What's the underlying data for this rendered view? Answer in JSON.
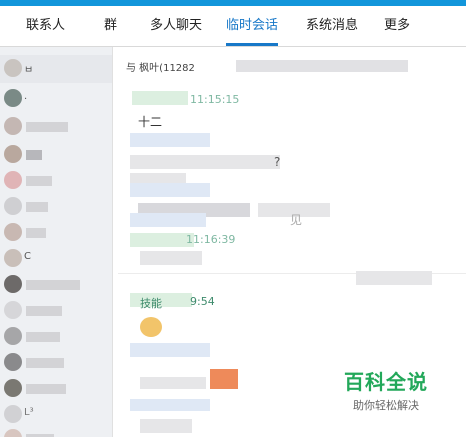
{
  "tabs": [
    {
      "label": "联系人"
    },
    {
      "label": "群"
    },
    {
      "label": "多人聊天"
    },
    {
      "label": "临时会话",
      "active": true
    },
    {
      "label": "系统消息"
    },
    {
      "label": "更多"
    }
  ],
  "sidebar": {
    "contacts": [
      {
        "visible_text": "ㅂ"
      },
      {
        "visible_text": "."
      },
      {
        "visible_text": ""
      },
      {
        "visible_text": ""
      },
      {
        "visible_text": ""
      },
      {
        "visible_text": ""
      },
      {
        "visible_text": ""
      },
      {
        "visible_text": "C"
      },
      {
        "visible_text": ""
      },
      {
        "visible_text": ""
      },
      {
        "visible_text": ""
      },
      {
        "visible_text": ""
      },
      {
        "visible_text": ""
      },
      {
        "visible_text": "L³"
      },
      {
        "visible_text": ""
      }
    ]
  },
  "chat": {
    "header_prefix": "与 枫叶(11282",
    "messages": [
      {
        "time": "11:15:15",
        "text": "十二"
      },
      {
        "time": "11:16:39",
        "text": ""
      },
      {
        "time": "9:54",
        "sender_visible": "技能",
        "text": ""
      }
    ],
    "question_mark": "?",
    "partial_word": "见"
  },
  "watermark": {
    "title": "百科全说",
    "subtitle": "助你轻松解决"
  },
  "colors": {
    "accent": "#1878c8",
    "top_strip": "#1296db",
    "watermark_green": "#23a85a",
    "sidebar_bg": "#eef0f3"
  }
}
